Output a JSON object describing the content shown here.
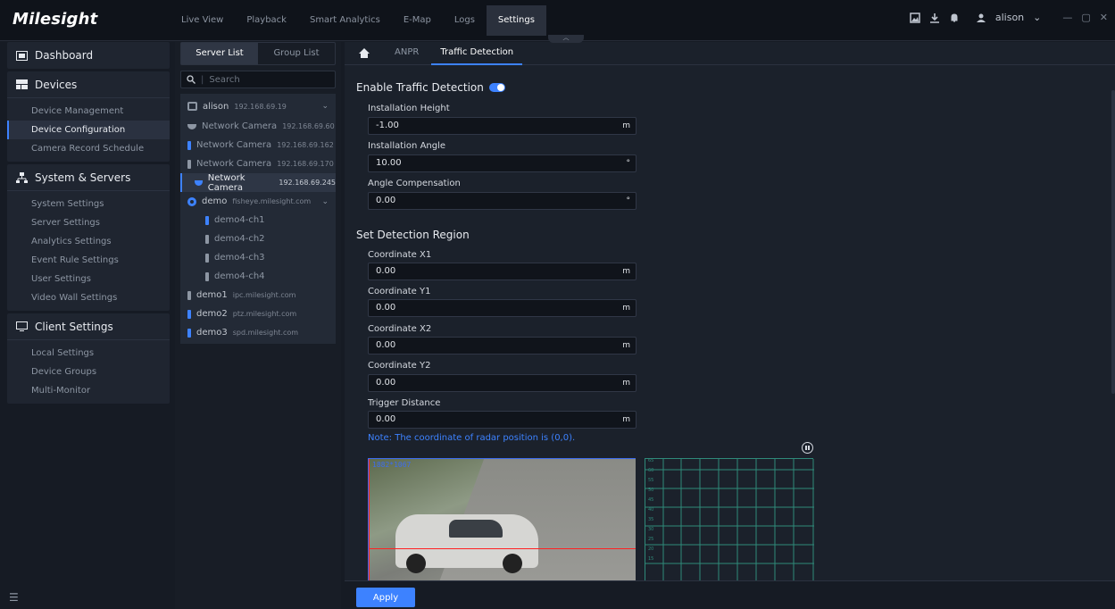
{
  "app": {
    "logo": "Milesight"
  },
  "nav_tabs": [
    "Live View",
    "Playback",
    "Smart Analytics",
    "E-Map",
    "Logs",
    "Settings"
  ],
  "active_nav_tab": "Settings",
  "user": {
    "name": "alison",
    "chevron": "⌄"
  },
  "window_controls": {
    "minimize": "—",
    "restore": "▢",
    "close": "✕"
  },
  "leftnav": {
    "dashboard": "Dashboard",
    "devices": {
      "title": "Devices",
      "items": [
        "Device Management",
        "Device Configuration",
        "Camera Record Schedule"
      ]
    },
    "system": {
      "title": "System & Servers",
      "items": [
        "System Settings",
        "Server Settings",
        "Analytics Settings",
        "Event Rule Settings",
        "User Settings",
        "Video Wall Settings"
      ]
    },
    "client": {
      "title": "Client Settings",
      "items": [
        "Local Settings",
        "Device Groups",
        "Multi-Monitor"
      ]
    },
    "menu_icon": "☰"
  },
  "server_pane": {
    "tabs": [
      "Server List",
      "Group List"
    ],
    "search_placeholder": "Search",
    "tree": [
      {
        "name": "alison",
        "ip": "192.168.69.19"
      },
      {
        "name": "Network Camera",
        "ip": "192.168.69.60"
      },
      {
        "name": "Network Camera",
        "ip": "192.168.69.162"
      },
      {
        "name": "Network Camera",
        "ip": "192.168.69.170"
      },
      {
        "name": "Network Camera",
        "ip": "192.168.69.245"
      },
      {
        "name": "demo",
        "ip": "fisheye.milesight.com"
      },
      {
        "name": "demo4-ch1",
        "ip": ""
      },
      {
        "name": "demo4-ch2",
        "ip": ""
      },
      {
        "name": "demo4-ch3",
        "ip": ""
      },
      {
        "name": "demo4-ch4",
        "ip": ""
      },
      {
        "name": "demo1",
        "ip": "ipc.milesight.com"
      },
      {
        "name": "demo2",
        "ip": "ptz.milesight.com"
      },
      {
        "name": "demo3",
        "ip": "spd.milesight.com"
      }
    ]
  },
  "main": {
    "subtabs": [
      "ANPR",
      "Traffic Detection"
    ],
    "enable_label": "Enable Traffic Detection",
    "enabled": true,
    "fields": [
      {
        "label": "Installation Height",
        "value": "-1.00",
        "unit": "m"
      },
      {
        "label": "Installation Angle",
        "value": "10.00",
        "unit": "°"
      },
      {
        "label": "Angle Compensation",
        "value": "0.00",
        "unit": "°"
      }
    ],
    "region_title": "Set Detection Region",
    "region_fields": [
      {
        "label": "Coordinate X1",
        "value": "0.00",
        "unit": "m"
      },
      {
        "label": "Coordinate Y1",
        "value": "0.00",
        "unit": "m"
      },
      {
        "label": "Coordinate X2",
        "value": "0.00",
        "unit": "m"
      },
      {
        "label": "Coordinate Y2",
        "value": "0.00",
        "unit": "m"
      },
      {
        "label": "Trigger Distance",
        "value": "0.00",
        "unit": "m"
      }
    ],
    "note": "Note: The coordinate of radar position is (0,0).",
    "video_resolution": "1882*1067",
    "radar_ticks": [
      "65",
      "60",
      "55",
      "50",
      "45",
      "40",
      "35",
      "30",
      "25",
      "20",
      "15"
    ],
    "apply_label": "Apply"
  }
}
